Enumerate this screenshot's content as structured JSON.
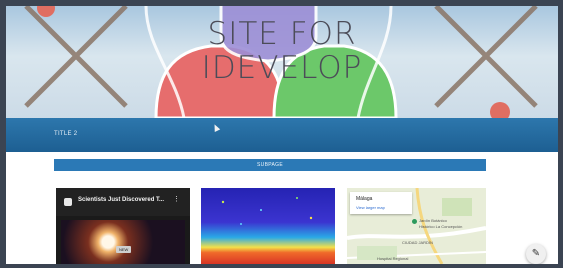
{
  "hero": {
    "title_line1": "SITE FOR",
    "title_line2": "IDEVELOP"
  },
  "nav": {
    "item1": "TITLE 2"
  },
  "subpage": {
    "label": "SUBPAGE"
  },
  "video": {
    "title": "Scientists Just Discovered T...",
    "badge": "NEW"
  },
  "map": {
    "place": "Málaga",
    "link": "View larger map",
    "label_garden": "Jardín Botánico",
    "label_garden2": "Histórico La Concepción",
    "label_area": "CIUDAD JARDÍN",
    "label_hospital": "Hospital Regional"
  },
  "icons": {
    "edit": "pencil-icon",
    "menu": "more-vert-icon"
  }
}
